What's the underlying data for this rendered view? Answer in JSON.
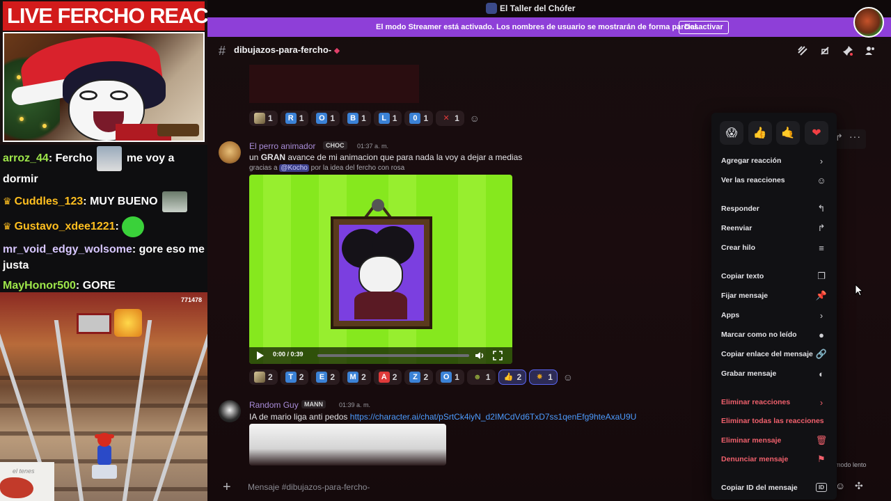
{
  "stream": {
    "title": "LIVE FERCHO REACTION",
    "chat": [
      {
        "user": "arroz_44",
        "user_color": "#9ee64a",
        "crown": false,
        "text_before": "Fercho",
        "emote": "emote-ya",
        "text_after": "me voy a dormir"
      },
      {
        "user": "Cuddles_123",
        "user_color": "#ffbf1f",
        "crown": true,
        "text_before": "MUY BUENO",
        "emote": "emote-cat",
        "text_after": ""
      },
      {
        "user": "Gustavo_xdee1221",
        "user_color": "#ffbf1f",
        "crown": true,
        "text_before": "",
        "emote": "emote-green-face",
        "text_after": ""
      },
      {
        "user": "mr_void_edgy_wolsome",
        "user_color": "#d8c7ff",
        "crown": false,
        "text_before": "gore eso me justa",
        "emote": "",
        "text_after": ""
      },
      {
        "user": "MayHonor500",
        "user_color": "#9ee64a",
        "crown": false,
        "text_before": "GORE",
        "emote": "",
        "text_after": ""
      }
    ],
    "game_score": "771478",
    "webcam_caption": "el tenes"
  },
  "discord": {
    "server_title": "El Taller del Chófer",
    "streamer_banner": {
      "text": "El modo Streamer está activado. Los nombres de usuario se mostrarán de forma parcial.",
      "button": "Desactivar",
      "color": "#8e3fd8"
    },
    "channel": {
      "name": "dibujazos-para-fercho-",
      "hash": "#"
    },
    "reactions_top": [
      {
        "glyph": "img-a",
        "color": "#8a6a3a",
        "count": "1"
      },
      {
        "glyph": "R",
        "color": "#3b82d6",
        "count": "1"
      },
      {
        "glyph": "O",
        "color": "#3b82d6",
        "count": "1"
      },
      {
        "glyph": "B",
        "color": "#3b82d6",
        "count": "1"
      },
      {
        "glyph": "L",
        "color": "#3b82d6",
        "count": "1"
      },
      {
        "glyph": "0",
        "color": "#3b82d6",
        "count": "1"
      },
      {
        "glyph": "✕",
        "color": "#e03a3a",
        "count": "1"
      }
    ],
    "message1": {
      "author": "El perro animador",
      "author_color": "#a88cd8",
      "tag": "CHOC",
      "time": "01:37 a. m.",
      "text_pre": "un ",
      "text_bold": "GRAN",
      "text_post": " avance de mi animacion que para nada la voy a dejar a medias",
      "sub_pre": "gracias a ",
      "sub_mention": "@Kocho",
      "sub_post": " por la idea del fercho con rosa",
      "video_time": "0:00 / 0:39",
      "video_progress": 0
    },
    "reactions_mid": [
      {
        "glyph": "img-a",
        "color": "#8a6a3a",
        "count": "2",
        "mine": false
      },
      {
        "glyph": "T",
        "color": "#3b82d6",
        "count": "2",
        "mine": false
      },
      {
        "glyph": "E",
        "color": "#3b82d6",
        "count": "2",
        "mine": false
      },
      {
        "glyph": "M",
        "color": "#3b82d6",
        "count": "2",
        "mine": false
      },
      {
        "glyph": "A",
        "color": "#e03a3a",
        "count": "2",
        "mine": false
      },
      {
        "glyph": "Z",
        "color": "#3b82d6",
        "count": "2",
        "mine": false
      },
      {
        "glyph": "O",
        "color": "#3b82d6",
        "count": "1",
        "mine": false
      },
      {
        "glyph": "☻",
        "color": "#8aa03a",
        "count": "1",
        "mine": false
      },
      {
        "glyph": "👍",
        "color": "#2d2b55",
        "count": "2",
        "mine": true
      },
      {
        "glyph": "✸",
        "color": "#e0a020",
        "count": "1",
        "mine": true
      }
    ],
    "message2": {
      "author": "Random Guy",
      "author_color": "#a88cd8",
      "tag": "MANN",
      "time": "01:39 a. m.",
      "text": "IA de mario liga anti pedos ",
      "link": "https://character.ai/chat/pSrtCk4iyN_d2IMCdVd6TxD7ss1qenEfg9hteAxaU9U"
    },
    "composer_placeholder": "Mensaje #dibujazos-para-fercho-",
    "slow_mode": "modo lento"
  },
  "context_menu": {
    "quick_reactions": [
      "😱",
      "👍",
      "🤙",
      "❤"
    ],
    "items": [
      {
        "label": "Agregar reacción",
        "icon": "›",
        "danger": false,
        "name": "menu-add-reaction"
      },
      {
        "label": "Ver las reacciones",
        "icon": "☺",
        "danger": false,
        "name": "menu-view-reactions"
      },
      {
        "label": "Responder",
        "icon": "↰",
        "danger": false,
        "name": "menu-reply"
      },
      {
        "label": "Reenviar",
        "icon": "↱",
        "danger": false,
        "name": "menu-forward"
      },
      {
        "label": "Crear hilo",
        "icon": "≡",
        "danger": false,
        "name": "menu-create-thread"
      },
      {
        "label": "Copiar texto",
        "icon": "❐",
        "danger": false,
        "name": "menu-copy-text"
      },
      {
        "label": "Fijar mensaje",
        "icon": "📌",
        "danger": false,
        "name": "menu-pin-message"
      },
      {
        "label": "Apps",
        "icon": "›",
        "danger": false,
        "name": "menu-apps"
      },
      {
        "label": "Marcar como no leído",
        "icon": "●",
        "danger": false,
        "name": "menu-mark-unread"
      },
      {
        "label": "Copiar enlace del mensaje",
        "icon": "🔗",
        "danger": false,
        "name": "menu-copy-link"
      },
      {
        "label": "Grabar mensaje",
        "icon": "◐",
        "danger": false,
        "name": "menu-record-message"
      },
      {
        "label": "Eliminar reacciones",
        "icon": "›",
        "danger": true,
        "name": "menu-remove-reactions"
      },
      {
        "label": "Eliminar todas las reacciones",
        "icon": "",
        "danger": true,
        "name": "menu-remove-all-reactions"
      },
      {
        "label": "Eliminar mensaje",
        "icon": "🗑",
        "danger": true,
        "name": "menu-delete-message"
      },
      {
        "label": "Denunciar mensaje",
        "icon": "⚑",
        "danger": true,
        "name": "menu-report-message"
      },
      {
        "label": "Copiar ID del mensaje",
        "icon": "ID",
        "danger": false,
        "name": "menu-copy-id"
      }
    ]
  }
}
